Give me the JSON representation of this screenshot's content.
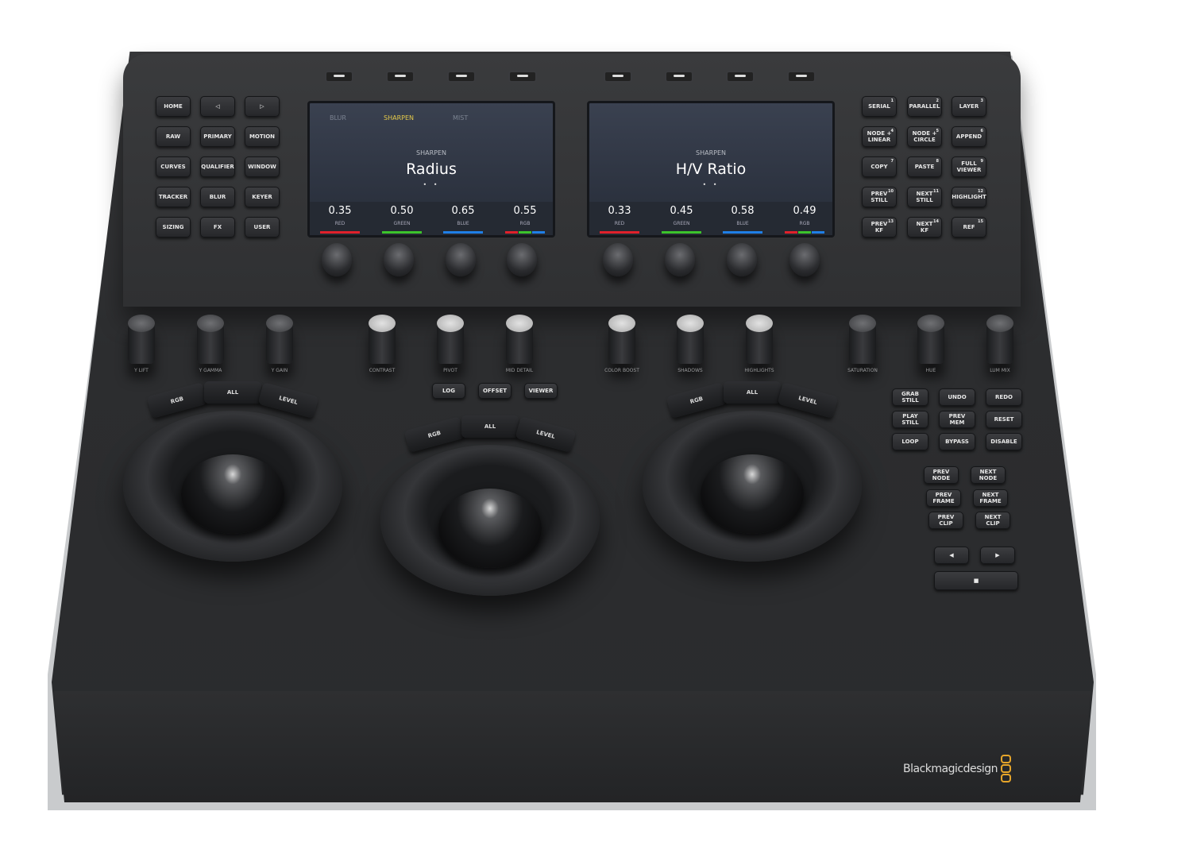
{
  "soft_keys_count": 8,
  "left_buttons": [
    "HOME",
    "◁",
    "▷",
    "RAW",
    "PRIMARY",
    "MOTION",
    "CURVES",
    "QUALIFIER",
    "WINDOW",
    "TRACKER",
    "BLUR",
    "KEYER",
    "SIZING",
    "FX",
    "USER"
  ],
  "right_buttons": [
    {
      "label": "SERIAL",
      "num": "1"
    },
    {
      "label": "PARALLEL",
      "num": "2"
    },
    {
      "label": "LAYER",
      "num": "3"
    },
    {
      "label": "NODE +\nLINEAR",
      "num": "4"
    },
    {
      "label": "NODE +\nCIRCLE",
      "num": "5"
    },
    {
      "label": "APPEND",
      "num": "6"
    },
    {
      "label": "COPY",
      "num": "7"
    },
    {
      "label": "PASTE",
      "num": "8"
    },
    {
      "label": "FULL\nVIEWER",
      "num": "9"
    },
    {
      "label": "PREV\nSTILL",
      "num": "10"
    },
    {
      "label": "NEXT\nSTILL",
      "num": "11"
    },
    {
      "label": "HIGHLIGHT",
      "num": "12"
    },
    {
      "label": "PREV\nKF",
      "num": "13"
    },
    {
      "label": "NEXT\nKF",
      "num": "14"
    },
    {
      "label": "REF",
      "num": "15"
    }
  ],
  "screens": [
    {
      "tabs": [
        {
          "label": "BLUR",
          "active": false
        },
        {
          "label": "SHARPEN",
          "active": true
        },
        {
          "label": "MIST",
          "active": false
        }
      ],
      "subtitle": "SHARPEN",
      "title": "Radius",
      "page_dots": "• •",
      "params": [
        {
          "value": "0.35",
          "label": "RED"
        },
        {
          "value": "0.50",
          "label": "GREEN"
        },
        {
          "value": "0.65",
          "label": "BLUE"
        },
        {
          "value": "0.55",
          "label": "RGB"
        }
      ]
    },
    {
      "tabs": [],
      "subtitle": "SHARPEN",
      "title": "H/V Ratio",
      "page_dots": "• •",
      "params": [
        {
          "value": "0.33",
          "label": "RED"
        },
        {
          "value": "0.45",
          "label": "GREEN"
        },
        {
          "value": "0.58",
          "label": "BLUE"
        },
        {
          "value": "0.49",
          "label": "RGB"
        }
      ]
    }
  ],
  "channel_colors": {
    "RED": "#e0212b",
    "GREEN": "#3cc32c",
    "BLUE": "#1f7fe6",
    "tab_active": "#e4c94a"
  },
  "tall_knobs": [
    {
      "label": "Y LIFT",
      "cap": "dark"
    },
    {
      "label": "Y GAMMA",
      "cap": "dark"
    },
    {
      "label": "Y GAIN",
      "cap": "dark"
    },
    {
      "label": "CONTRAST",
      "cap": "light"
    },
    {
      "label": "PIVOT",
      "cap": "light"
    },
    {
      "label": "MID DETAIL",
      "cap": "light"
    },
    {
      "label": "COLOR BOOST",
      "cap": "light"
    },
    {
      "label": "SHADOWS",
      "cap": "light"
    },
    {
      "label": "HIGHLIGHTS",
      "cap": "light"
    },
    {
      "label": "SATURATION",
      "cap": "dark"
    },
    {
      "label": "HUE",
      "cap": "dark"
    },
    {
      "label": "LUM MIX",
      "cap": "dark"
    }
  ],
  "center_buttons": [
    "LOG",
    "OFFSET",
    "VIEWER"
  ],
  "trackball_buttons": [
    "RGB",
    "ALL",
    "LEVEL"
  ],
  "transport_buttons": [
    "GRAB\nSTILL",
    "UNDO",
    "REDO",
    "PLAY\nSTILL",
    "PREV\nMEM",
    "RESET",
    "LOOP",
    "BYPASS",
    "DISABLE"
  ],
  "nav_buttons": [
    "PREV\nNODE",
    "NEXT\nNODE",
    "PREV\nFRAME",
    "NEXT\nFRAME",
    "PREV\nCLIP",
    "NEXT\nCLIP"
  ],
  "play_buttons": [
    "◀",
    "▶",
    "■"
  ],
  "logo": "Blackmagicdesign",
  "logo_color": "#e6a52a"
}
